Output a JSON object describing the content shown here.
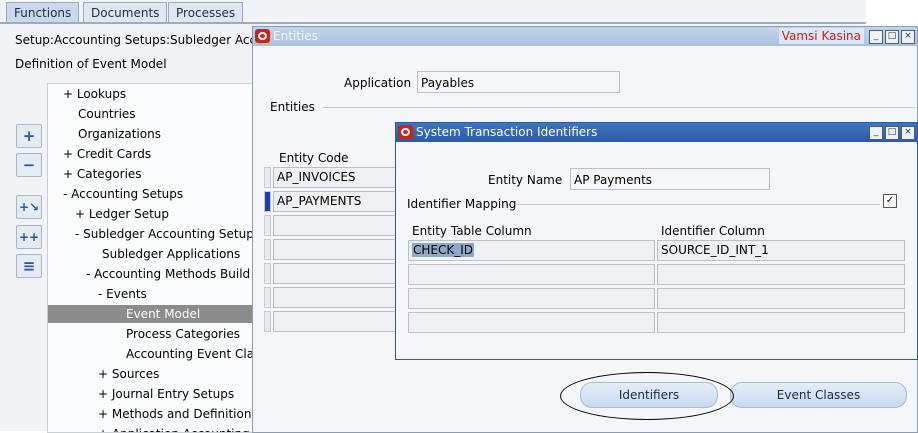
{
  "navigator": {
    "tabs": [
      {
        "label": "Functions"
      },
      {
        "label": "Documents"
      },
      {
        "label": "Processes"
      }
    ],
    "path": "Setup:Accounting Setups:Subledger Acc",
    "subtitle": "Definition of Event Model",
    "side_buttons": [
      "plus-icon",
      "minus-icon",
      "expand-branch-icon",
      "expand-all-icon",
      "collapse-all-icon"
    ],
    "tree": [
      {
        "label": "+  Lookups"
      },
      {
        "label": "Countries"
      },
      {
        "label": "Organizations"
      },
      {
        "label": "+  Credit Cards"
      },
      {
        "label": "+  Categories"
      },
      {
        "label": "-  Accounting Setups"
      },
      {
        "label": "+  Ledger Setup"
      },
      {
        "label": "-  Subledger Accounting Setup"
      },
      {
        "label": "Subledger Applications"
      },
      {
        "label": "-  Accounting Methods Build"
      },
      {
        "label": "-  Events"
      },
      {
        "label": "Event Model"
      },
      {
        "label": "Process Categories"
      },
      {
        "label": "Accounting Event Cla"
      },
      {
        "label": "+  Sources"
      },
      {
        "label": "+  Journal Entry Setups"
      },
      {
        "label": "+  Methods and Definitions"
      },
      {
        "label": "+  Application Accounting"
      }
    ]
  },
  "entities_window": {
    "title": "Entities",
    "user": "Vamsi Kasina",
    "application_label": "Application",
    "application_value": "Payables",
    "section_label": "Entities",
    "column_entity_code": "Entity Code",
    "rows": [
      "AP_INVOICES",
      "AP_PAYMENTS",
      "",
      "",
      "",
      "",
      ""
    ],
    "buttons": {
      "identifiers": "Identifiers",
      "event_classes": "Event Classes"
    }
  },
  "sti_window": {
    "title": "System Transaction Identifiers",
    "entity_name_label": "Entity Name",
    "entity_name_value": "AP Payments",
    "mapping_label": "Identifier Mapping",
    "checkbox_mark": "✓",
    "col_table": "Entity Table Column",
    "col_identifier": "Identifier Column",
    "rows": [
      {
        "table": "CHECK_ID",
        "identifier": "SOURCE_ID_INT_1"
      },
      {
        "table": "",
        "identifier": ""
      },
      {
        "table": "",
        "identifier": ""
      },
      {
        "table": "",
        "identifier": ""
      }
    ]
  },
  "colors": {
    "accent": "#2b5aa6",
    "user_name": "#c82020",
    "oracle_red": "#c8231c"
  }
}
